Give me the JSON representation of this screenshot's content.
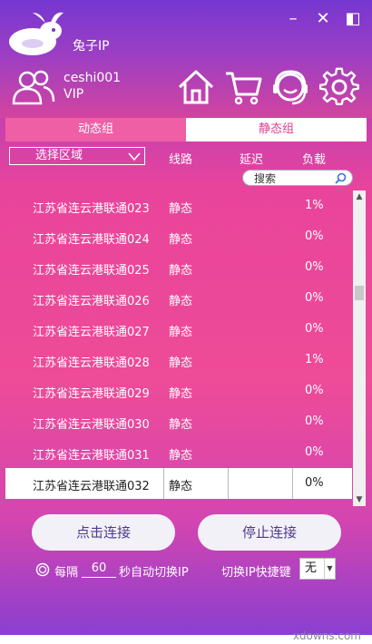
{
  "app": {
    "title": "兔子IP"
  },
  "window": {
    "minimize": "–",
    "close": "✕",
    "side": "◧"
  },
  "user": {
    "name": "ceshi001",
    "level": "VIP"
  },
  "tabs": [
    {
      "label": "动态组",
      "active": false
    },
    {
      "label": "静态组",
      "active": true
    }
  ],
  "filters": {
    "region_label": "选择区域",
    "columns": {
      "route": "线路",
      "delay": "延迟",
      "load": "负载"
    },
    "search_placeholder": "搜索"
  },
  "rows": [
    {
      "name": "江苏省连云港联通023",
      "route": "静态",
      "delay": "",
      "load": "1%"
    },
    {
      "name": "江苏省连云港联通024",
      "route": "静态",
      "delay": "",
      "load": "0%"
    },
    {
      "name": "江苏省连云港联通025",
      "route": "静态",
      "delay": "",
      "load": "0%"
    },
    {
      "name": "江苏省连云港联通026",
      "route": "静态",
      "delay": "",
      "load": "0%"
    },
    {
      "name": "江苏省连云港联通027",
      "route": "静态",
      "delay": "",
      "load": "0%"
    },
    {
      "name": "江苏省连云港联通028",
      "route": "静态",
      "delay": "",
      "load": "1%"
    },
    {
      "name": "江苏省连云港联通029",
      "route": "静态",
      "delay": "",
      "load": "0%"
    },
    {
      "name": "江苏省连云港联通030",
      "route": "静态",
      "delay": "",
      "load": "0%"
    },
    {
      "name": "江苏省连云港联通031",
      "route": "静态",
      "delay": "",
      "load": "0%"
    },
    {
      "name": "江苏省连云港联通032",
      "route": "静态",
      "delay": "",
      "load": "0%",
      "selected": true
    }
  ],
  "actions": {
    "connect": "点击连接",
    "stop": "停止连接"
  },
  "auto_switch": {
    "prefix": "每隔",
    "interval": "60",
    "suffix": "秒自动切换IP"
  },
  "hotkey": {
    "label": "切换IP快捷键",
    "value": "无"
  },
  "watermark": "xdowns.com",
  "colors": {
    "accent": "#e9449b",
    "header": "#7637d0",
    "button_text": "#4d3a8e"
  }
}
